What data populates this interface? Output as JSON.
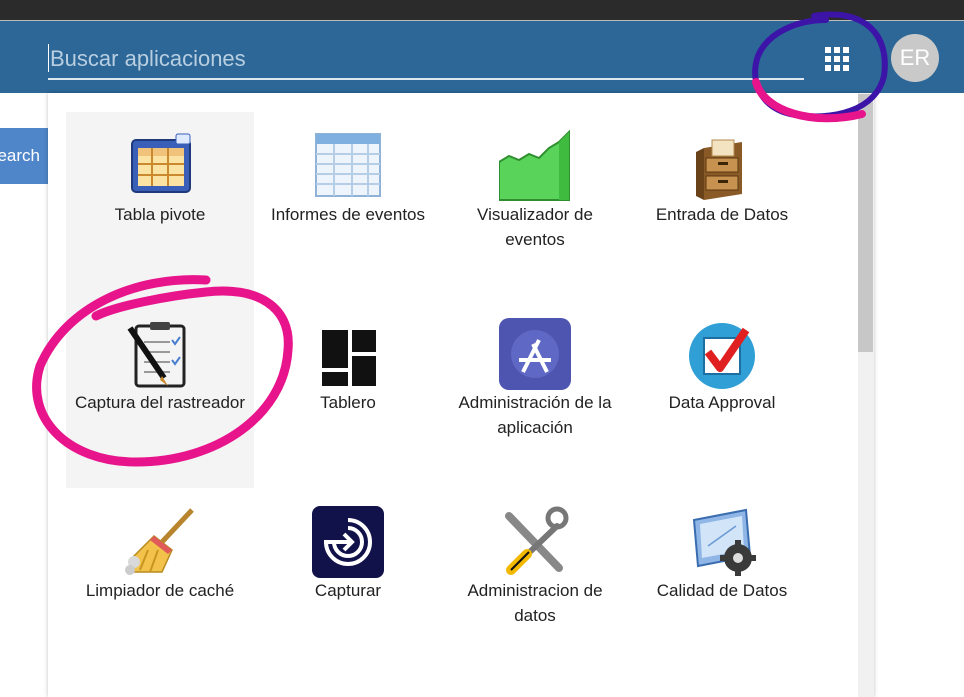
{
  "search": {
    "placeholder": "Buscar aplicaciones"
  },
  "user": {
    "initials": "ER"
  },
  "side_search_button": {
    "label": "earch"
  },
  "apps": [
    {
      "label": "Tabla pivote",
      "icon": "pivot-table-icon"
    },
    {
      "label": "Informes de eventos",
      "icon": "event-reports-icon"
    },
    {
      "label": "Visualizador de eventos",
      "icon": "event-visualizer-icon"
    },
    {
      "label": "Entrada de Datos",
      "icon": "data-entry-icon"
    },
    {
      "label": "Captura del rastreador",
      "icon": "tracker-capture-icon"
    },
    {
      "label": "Tablero",
      "icon": "dashboard-icon"
    },
    {
      "label": "Administración de la aplicación",
      "icon": "app-management-icon"
    },
    {
      "label": "Data Approval",
      "icon": "data-approval-icon"
    },
    {
      "label": "Limpiador de caché",
      "icon": "cache-cleaner-icon"
    },
    {
      "label": "Capturar",
      "icon": "capture-icon"
    },
    {
      "label": "Administracion de datos",
      "icon": "data-administration-icon"
    },
    {
      "label": "Calidad de Datos",
      "icon": "data-quality-icon"
    }
  ],
  "colors": {
    "header": "#2c6797",
    "annotation_pink": "#e8148c",
    "annotation_purple": "#3c14a8"
  }
}
